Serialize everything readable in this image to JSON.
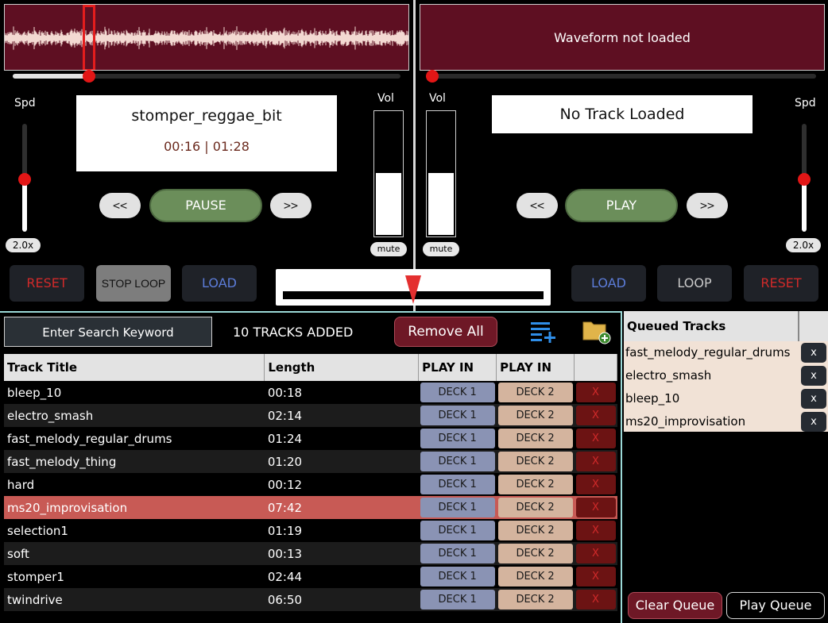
{
  "deck_left": {
    "waveform_status": "",
    "speed_label": "Spd",
    "track_title": "stomper_reggae_bit",
    "time": "00:16 | 01:28",
    "prev_label": "<<",
    "play_label": "PAUSE",
    "next_label": ">>",
    "speed_value": "2.0x",
    "volume_label": "Vol",
    "mute_label": "mute",
    "reset_label": "RESET",
    "loop_label": "STOP LOOP",
    "load_label": "LOAD",
    "position_fraction": 0.19,
    "speed_fraction": 0.5,
    "volume_fraction": 0.5
  },
  "deck_right": {
    "waveform_status": "Waveform not loaded",
    "speed_label": "Spd",
    "track_title": "No Track Loaded",
    "prev_label": "<<",
    "play_label": "PLAY",
    "next_label": ">>",
    "speed_value": "2.0x",
    "volume_label": "Vol",
    "mute_label": "mute",
    "reset_label": "RESET",
    "loop_label": "LOOP",
    "load_label": "LOAD",
    "position_fraction": 0.0,
    "speed_fraction": 0.5,
    "volume_fraction": 0.5
  },
  "crossfader": {
    "value_fraction": 0.5
  },
  "library": {
    "search_placeholder": "Enter Search Keyword",
    "tracks_added": "10 TRACKS ADDED",
    "remove_all_label": "Remove All",
    "add_to_queue_icon": "playlist-add-icon",
    "add_folder_icon": "folder-add-icon",
    "columns": [
      "Track Title",
      "Length",
      "PLAY IN",
      "PLAY IN",
      ""
    ],
    "deck1_label": "DECK 1",
    "deck2_label": "DECK 2",
    "delete_label": "X",
    "tracks": [
      {
        "title": "bleep_10",
        "length": "00:18"
      },
      {
        "title": "electro_smash",
        "length": "02:14"
      },
      {
        "title": "fast_melody_regular_drums",
        "length": "01:24"
      },
      {
        "title": "fast_melody_thing",
        "length": "01:20"
      },
      {
        "title": "hard",
        "length": "00:12"
      },
      {
        "title": "ms20_improvisation",
        "length": "07:42"
      },
      {
        "title": "selection1",
        "length": "01:19"
      },
      {
        "title": "soft",
        "length": "00:13"
      },
      {
        "title": "stomper1",
        "length": "02:44"
      },
      {
        "title": "twindrive",
        "length": "06:50"
      }
    ],
    "selected_index": 5
  },
  "queue": {
    "title": "Queued Tracks",
    "remove_label": "x",
    "items": [
      "fast_melody_regular_drums",
      "electro_smash",
      "bleep_10",
      "ms20_improvisation"
    ],
    "clear_label": "Clear Queue",
    "play_label": "Play Queue"
  },
  "colors": {
    "waveform_bg": "#5e0f22",
    "waveform_line": "#f3d9d2",
    "accent_red": "#e21616",
    "play_green": "#6b8e5a",
    "selected_row": "#c85a55",
    "deck1_btn": "#8a93b4",
    "deck2_btn": "#d4b49e",
    "queue_bg": "#f1e2d6",
    "load_blue": "#5c7cd8",
    "reset_red": "#d02a2a"
  }
}
